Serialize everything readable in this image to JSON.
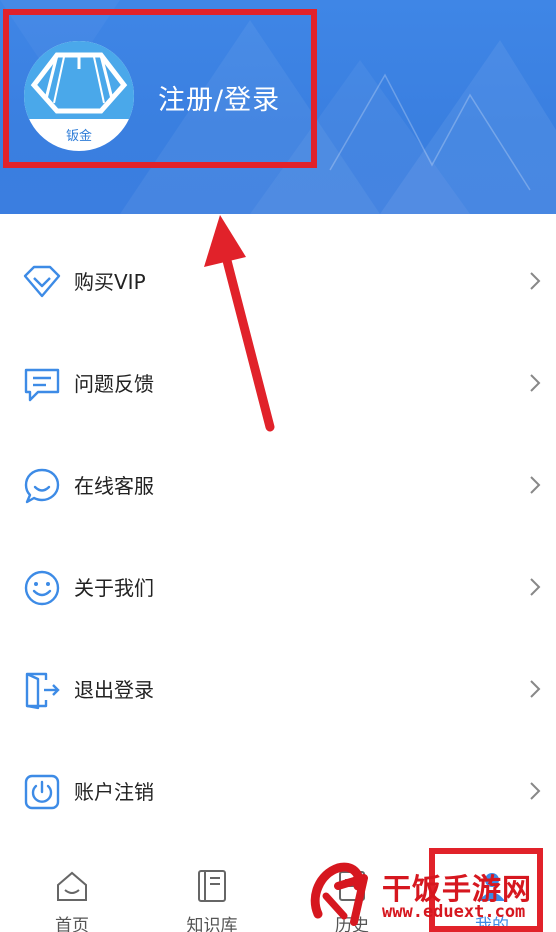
{
  "colors": {
    "header_blue": "#3b7ee0",
    "accent_blue": "#3d8be6",
    "highlight_red": "#e1222a"
  },
  "header": {
    "avatar_brand": "钣金",
    "login_label": "注册/登录"
  },
  "menu": {
    "items": [
      {
        "label": "购买VIP",
        "icon": "diamond-icon"
      },
      {
        "label": "问题反馈",
        "icon": "message-icon"
      },
      {
        "label": "在线客服",
        "icon": "chat-bubble-icon"
      },
      {
        "label": "关于我们",
        "icon": "smile-icon"
      },
      {
        "label": "退出登录",
        "icon": "exit-icon"
      },
      {
        "label": "账户注销",
        "icon": "power-icon"
      }
    ]
  },
  "bottom_nav": {
    "tabs": [
      {
        "label": "首页",
        "icon": "home-icon"
      },
      {
        "label": "知识库",
        "icon": "book-icon"
      },
      {
        "label": "历史",
        "icon": "history-icon"
      },
      {
        "label": "我的",
        "icon": "profile-icon",
        "active": true
      }
    ]
  },
  "watermark": {
    "title": "干饭手游网",
    "url": "www.eduext.com"
  }
}
